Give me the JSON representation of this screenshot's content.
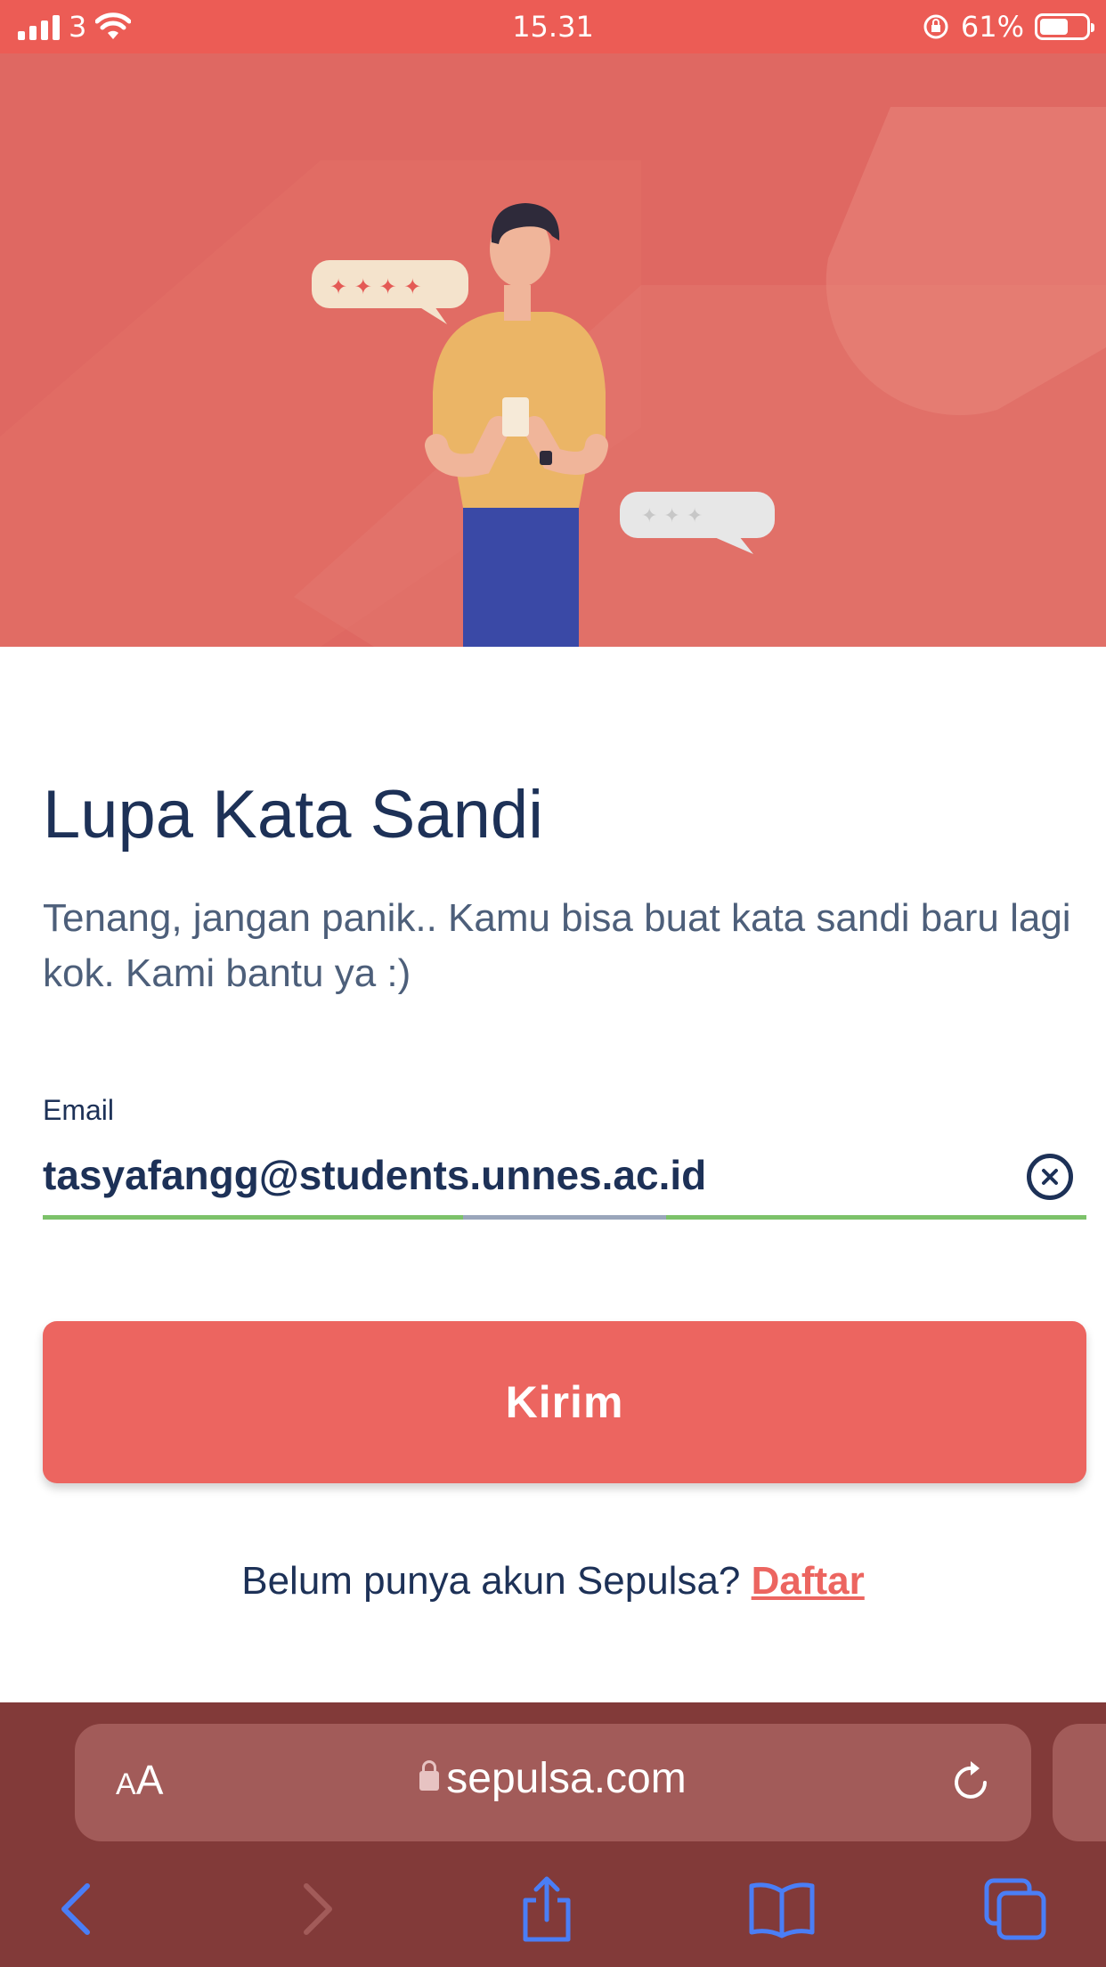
{
  "status_bar": {
    "carrier": "3",
    "time": "15.31",
    "battery_percent": "61%",
    "battery_level": 0.61
  },
  "hero": {
    "illustration": "person-with-phone-chat-bubbles"
  },
  "page": {
    "title": "Lupa Kata Sandi",
    "subtitle": "Tenang, jangan panik.. Kamu bisa buat kata sandi baru lagi kok. Kami bantu ya :)",
    "email_label": "Email",
    "email_value": "tasyafangg@students.unnes.ac.id",
    "submit_label": "Kirim",
    "signup_prompt": "Belum punya akun Sepulsa?",
    "signup_link": "Daftar"
  },
  "browser": {
    "text_size_button": "AA",
    "domain": "sepulsa.com",
    "icons": [
      "back-icon",
      "forward-icon",
      "share-icon",
      "bookmarks-icon",
      "tabs-icon"
    ]
  },
  "colors": {
    "accent": "#ec6560",
    "text_primary": "#1d3157",
    "underline_valid": "#7cc26a",
    "browser_bar": "#823a39"
  }
}
